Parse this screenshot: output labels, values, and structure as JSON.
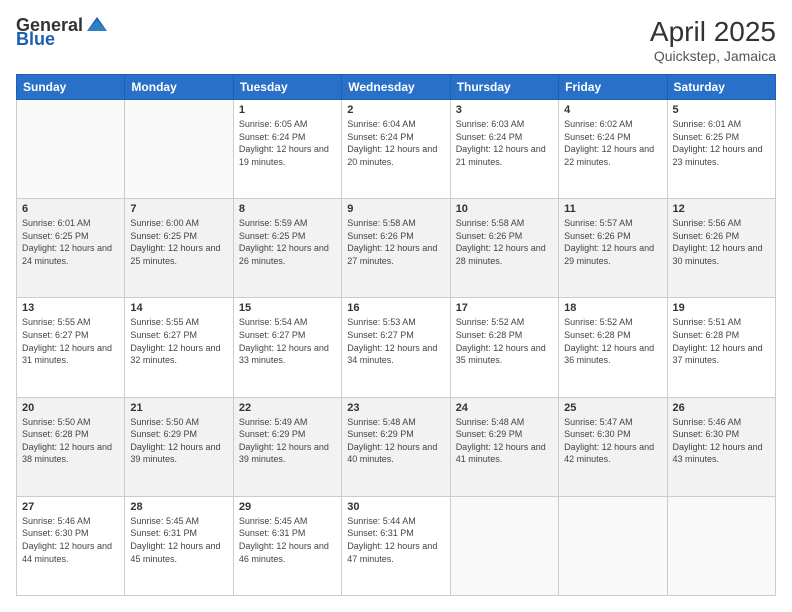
{
  "header": {
    "logo_general": "General",
    "logo_blue": "Blue",
    "title": "April 2025",
    "subtitle": "Quickstep, Jamaica"
  },
  "weekdays": [
    "Sunday",
    "Monday",
    "Tuesday",
    "Wednesday",
    "Thursday",
    "Friday",
    "Saturday"
  ],
  "weeks": [
    [
      {
        "day": "",
        "sunrise": "",
        "sunset": "",
        "daylight": ""
      },
      {
        "day": "",
        "sunrise": "",
        "sunset": "",
        "daylight": ""
      },
      {
        "day": "1",
        "sunrise": "Sunrise: 6:05 AM",
        "sunset": "Sunset: 6:24 PM",
        "daylight": "Daylight: 12 hours and 19 minutes."
      },
      {
        "day": "2",
        "sunrise": "Sunrise: 6:04 AM",
        "sunset": "Sunset: 6:24 PM",
        "daylight": "Daylight: 12 hours and 20 minutes."
      },
      {
        "day": "3",
        "sunrise": "Sunrise: 6:03 AM",
        "sunset": "Sunset: 6:24 PM",
        "daylight": "Daylight: 12 hours and 21 minutes."
      },
      {
        "day": "4",
        "sunrise": "Sunrise: 6:02 AM",
        "sunset": "Sunset: 6:24 PM",
        "daylight": "Daylight: 12 hours and 22 minutes."
      },
      {
        "day": "5",
        "sunrise": "Sunrise: 6:01 AM",
        "sunset": "Sunset: 6:25 PM",
        "daylight": "Daylight: 12 hours and 23 minutes."
      }
    ],
    [
      {
        "day": "6",
        "sunrise": "Sunrise: 6:01 AM",
        "sunset": "Sunset: 6:25 PM",
        "daylight": "Daylight: 12 hours and 24 minutes."
      },
      {
        "day": "7",
        "sunrise": "Sunrise: 6:00 AM",
        "sunset": "Sunset: 6:25 PM",
        "daylight": "Daylight: 12 hours and 25 minutes."
      },
      {
        "day": "8",
        "sunrise": "Sunrise: 5:59 AM",
        "sunset": "Sunset: 6:25 PM",
        "daylight": "Daylight: 12 hours and 26 minutes."
      },
      {
        "day": "9",
        "sunrise": "Sunrise: 5:58 AM",
        "sunset": "Sunset: 6:26 PM",
        "daylight": "Daylight: 12 hours and 27 minutes."
      },
      {
        "day": "10",
        "sunrise": "Sunrise: 5:58 AM",
        "sunset": "Sunset: 6:26 PM",
        "daylight": "Daylight: 12 hours and 28 minutes."
      },
      {
        "day": "11",
        "sunrise": "Sunrise: 5:57 AM",
        "sunset": "Sunset: 6:26 PM",
        "daylight": "Daylight: 12 hours and 29 minutes."
      },
      {
        "day": "12",
        "sunrise": "Sunrise: 5:56 AM",
        "sunset": "Sunset: 6:26 PM",
        "daylight": "Daylight: 12 hours and 30 minutes."
      }
    ],
    [
      {
        "day": "13",
        "sunrise": "Sunrise: 5:55 AM",
        "sunset": "Sunset: 6:27 PM",
        "daylight": "Daylight: 12 hours and 31 minutes."
      },
      {
        "day": "14",
        "sunrise": "Sunrise: 5:55 AM",
        "sunset": "Sunset: 6:27 PM",
        "daylight": "Daylight: 12 hours and 32 minutes."
      },
      {
        "day": "15",
        "sunrise": "Sunrise: 5:54 AM",
        "sunset": "Sunset: 6:27 PM",
        "daylight": "Daylight: 12 hours and 33 minutes."
      },
      {
        "day": "16",
        "sunrise": "Sunrise: 5:53 AM",
        "sunset": "Sunset: 6:27 PM",
        "daylight": "Daylight: 12 hours and 34 minutes."
      },
      {
        "day": "17",
        "sunrise": "Sunrise: 5:52 AM",
        "sunset": "Sunset: 6:28 PM",
        "daylight": "Daylight: 12 hours and 35 minutes."
      },
      {
        "day": "18",
        "sunrise": "Sunrise: 5:52 AM",
        "sunset": "Sunset: 6:28 PM",
        "daylight": "Daylight: 12 hours and 36 minutes."
      },
      {
        "day": "19",
        "sunrise": "Sunrise: 5:51 AM",
        "sunset": "Sunset: 6:28 PM",
        "daylight": "Daylight: 12 hours and 37 minutes."
      }
    ],
    [
      {
        "day": "20",
        "sunrise": "Sunrise: 5:50 AM",
        "sunset": "Sunset: 6:28 PM",
        "daylight": "Daylight: 12 hours and 38 minutes."
      },
      {
        "day": "21",
        "sunrise": "Sunrise: 5:50 AM",
        "sunset": "Sunset: 6:29 PM",
        "daylight": "Daylight: 12 hours and 39 minutes."
      },
      {
        "day": "22",
        "sunrise": "Sunrise: 5:49 AM",
        "sunset": "Sunset: 6:29 PM",
        "daylight": "Daylight: 12 hours and 39 minutes."
      },
      {
        "day": "23",
        "sunrise": "Sunrise: 5:48 AM",
        "sunset": "Sunset: 6:29 PM",
        "daylight": "Daylight: 12 hours and 40 minutes."
      },
      {
        "day": "24",
        "sunrise": "Sunrise: 5:48 AM",
        "sunset": "Sunset: 6:29 PM",
        "daylight": "Daylight: 12 hours and 41 minutes."
      },
      {
        "day": "25",
        "sunrise": "Sunrise: 5:47 AM",
        "sunset": "Sunset: 6:30 PM",
        "daylight": "Daylight: 12 hours and 42 minutes."
      },
      {
        "day": "26",
        "sunrise": "Sunrise: 5:46 AM",
        "sunset": "Sunset: 6:30 PM",
        "daylight": "Daylight: 12 hours and 43 minutes."
      }
    ],
    [
      {
        "day": "27",
        "sunrise": "Sunrise: 5:46 AM",
        "sunset": "Sunset: 6:30 PM",
        "daylight": "Daylight: 12 hours and 44 minutes."
      },
      {
        "day": "28",
        "sunrise": "Sunrise: 5:45 AM",
        "sunset": "Sunset: 6:31 PM",
        "daylight": "Daylight: 12 hours and 45 minutes."
      },
      {
        "day": "29",
        "sunrise": "Sunrise: 5:45 AM",
        "sunset": "Sunset: 6:31 PM",
        "daylight": "Daylight: 12 hours and 46 minutes."
      },
      {
        "day": "30",
        "sunrise": "Sunrise: 5:44 AM",
        "sunset": "Sunset: 6:31 PM",
        "daylight": "Daylight: 12 hours and 47 minutes."
      },
      {
        "day": "",
        "sunrise": "",
        "sunset": "",
        "daylight": ""
      },
      {
        "day": "",
        "sunrise": "",
        "sunset": "",
        "daylight": ""
      },
      {
        "day": "",
        "sunrise": "",
        "sunset": "",
        "daylight": ""
      }
    ]
  ]
}
